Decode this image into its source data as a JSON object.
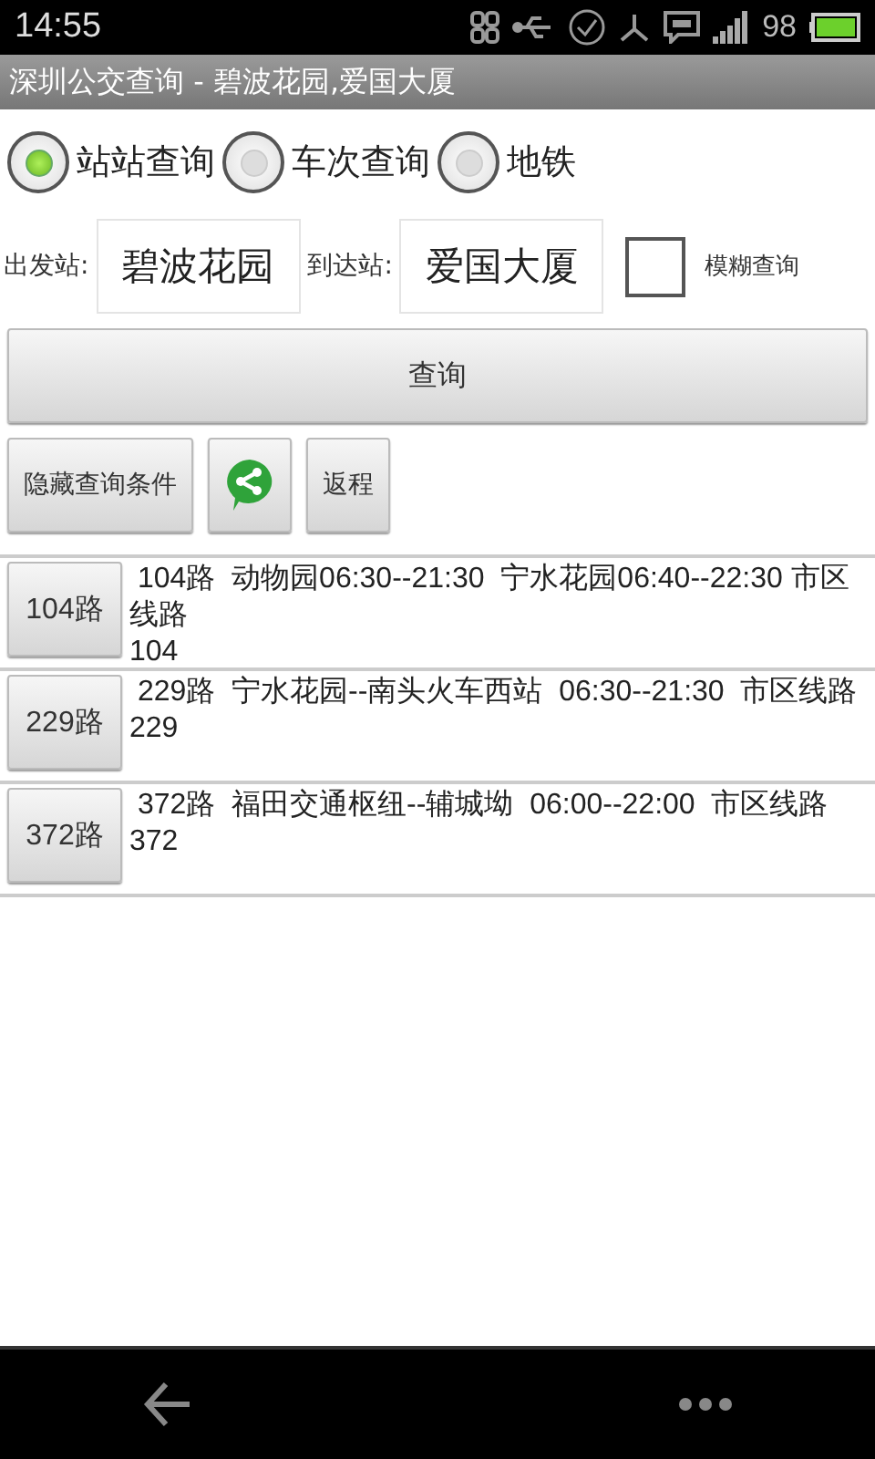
{
  "status_bar": {
    "time": "14:55",
    "battery_percent": "98"
  },
  "window": {
    "title": "深圳公交查询 - 碧波花园,爱国大厦"
  },
  "modes": [
    {
      "label": "站站查询",
      "selected": true
    },
    {
      "label": "车次查询",
      "selected": false
    },
    {
      "label": "地铁",
      "selected": false
    }
  ],
  "from": {
    "label": "出发站:",
    "value": "碧波花园"
  },
  "to": {
    "label": "到达站:",
    "value": "爱国大厦"
  },
  "fuzzy": {
    "label": "模糊查询",
    "checked": false
  },
  "query_button": "查询",
  "actions": [
    {
      "kind": "text",
      "label": "隐藏查询条件"
    },
    {
      "kind": "share"
    },
    {
      "kind": "text",
      "label": "返程"
    }
  ],
  "results": [
    {
      "button": "104路",
      "description": " 104路  动物园06:30--21:30  宁水花园06:40--22:30 市区线路",
      "code": "104"
    },
    {
      "button": "229路",
      "description": " 229路  宁水花园--南头火车西站  06:30--21:30  市区线路",
      "code": "229"
    },
    {
      "button": "372路",
      "description": " 372路  福田交通枢纽--辅城坳  06:00--22:00  市区线路",
      "code": "372"
    }
  ]
}
